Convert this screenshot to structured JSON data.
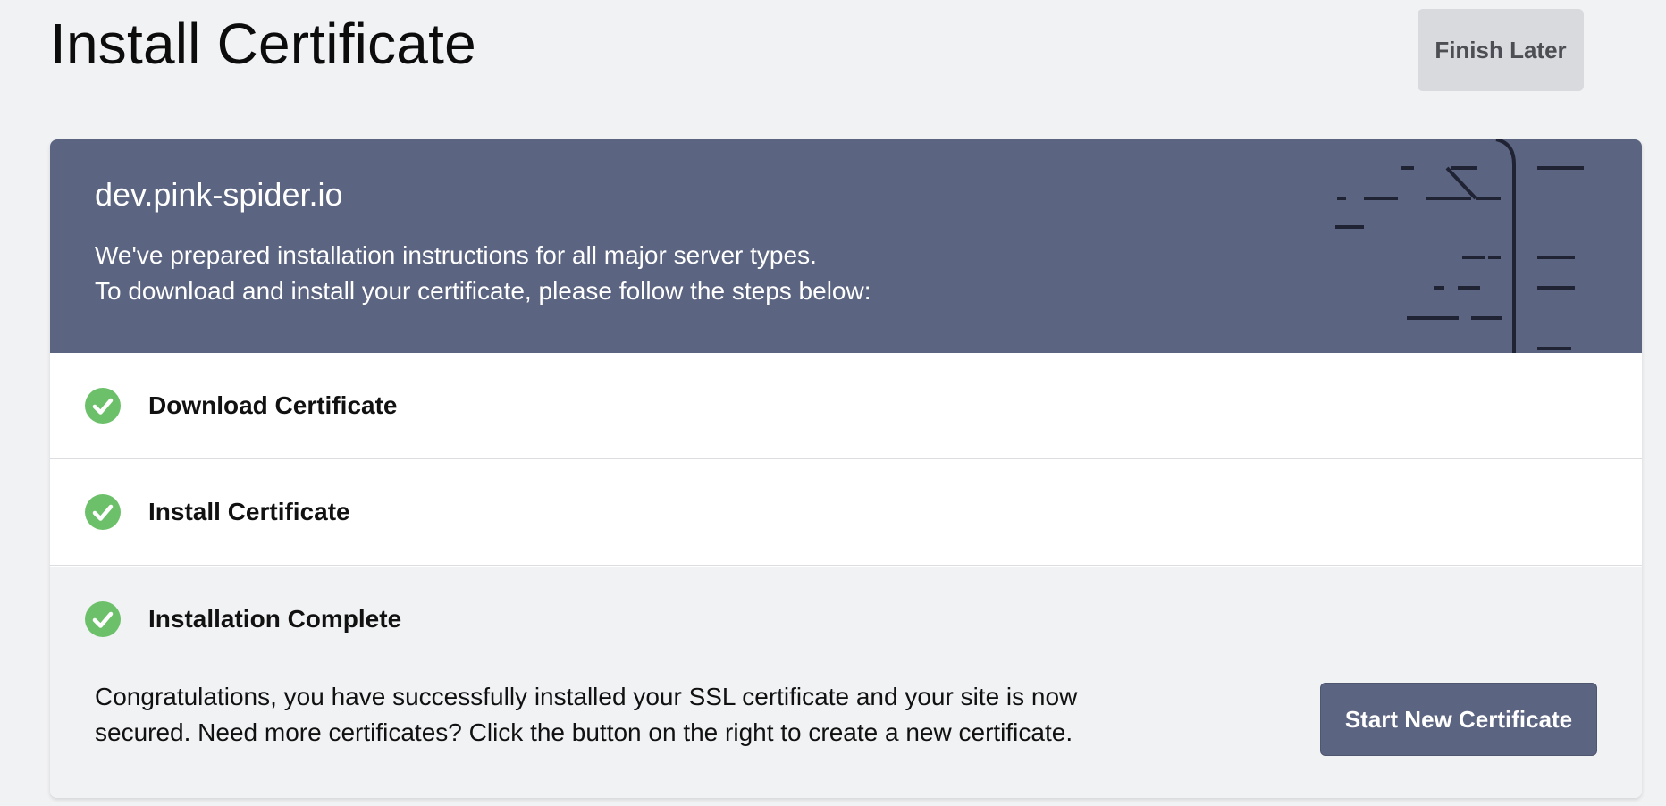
{
  "page": {
    "title": "Install Certificate",
    "finish_later_label": "Finish Later"
  },
  "banner": {
    "domain": "dev.pink-spider.io",
    "line1": "We've prepared installation instructions for all major server types.",
    "line2": "To download and install your certificate, please follow the steps below:"
  },
  "steps": [
    {
      "label": "Download Certificate",
      "status": "complete",
      "icon": "check-circle-icon"
    },
    {
      "label": "Install Certificate",
      "status": "complete",
      "icon": "check-circle-icon"
    },
    {
      "label": "Installation Complete",
      "status": "complete",
      "icon": "check-circle-icon"
    }
  ],
  "complete": {
    "message_line1": "Congratulations, you have successfully installed your SSL certificate and your site is now",
    "message_line2": "secured. Need more certificates? Click the button on the right to create a new certificate.",
    "start_new_label": "Start New Certificate"
  },
  "colors": {
    "accent": "#5b6480",
    "success": "#6cc06a",
    "background": "#f1f2f4"
  }
}
